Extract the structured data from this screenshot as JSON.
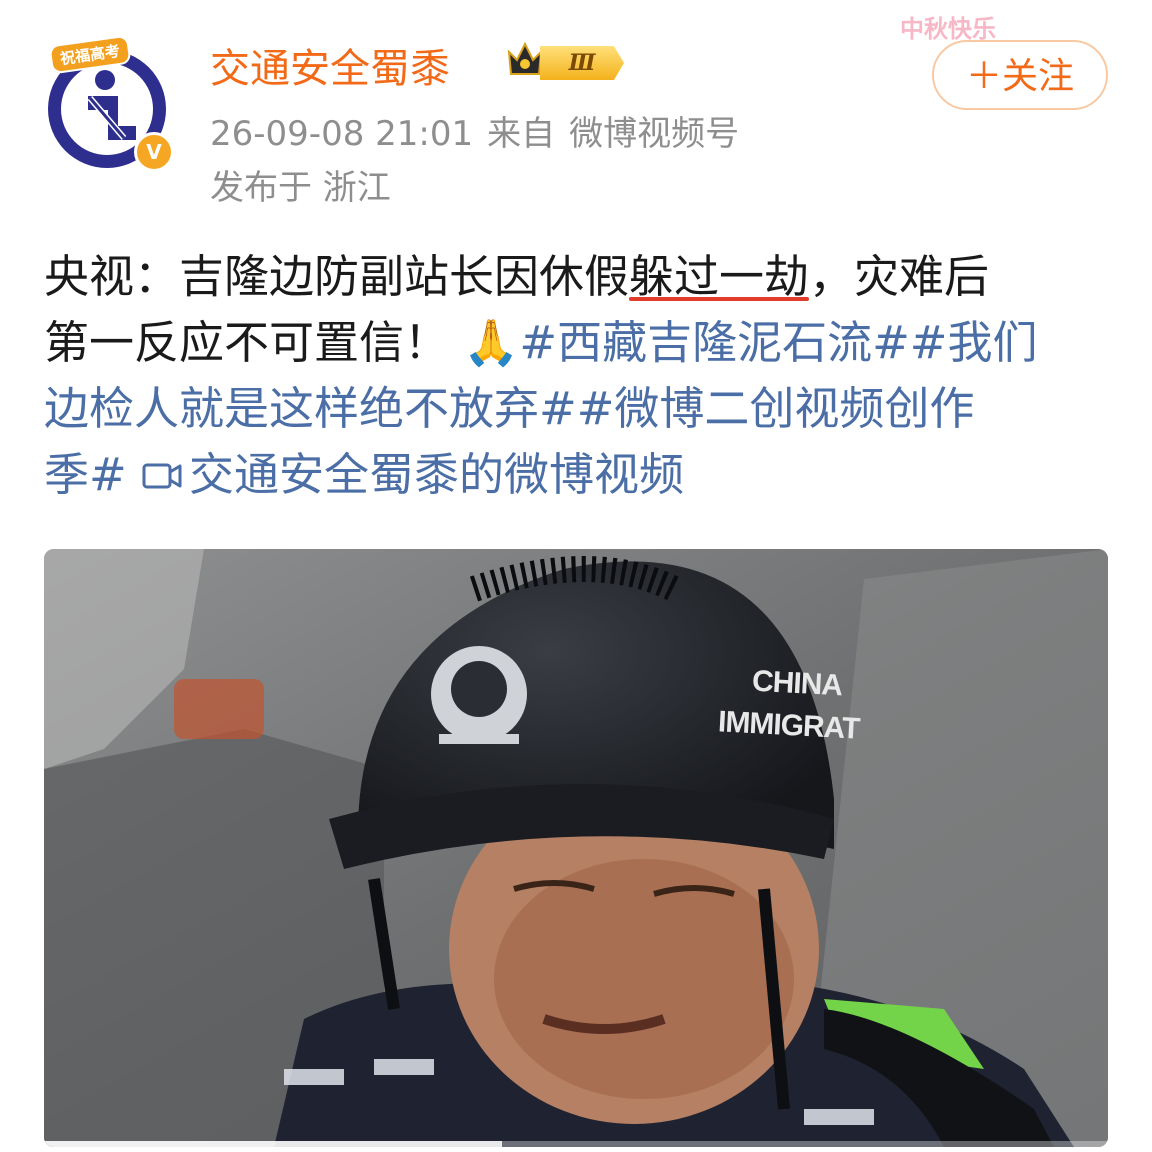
{
  "post": {
    "avatar_badge": "祝福高考",
    "author": "交通安全蜀黍",
    "level": "Ⅲ",
    "verified_mark": "V",
    "timestamp": "26-09-08 21:01",
    "source_prefix": "来自",
    "source": "微博视频号",
    "location": "发布于 浙江",
    "follow_label": "＋关注",
    "deco_text": "中秋快乐"
  },
  "content": {
    "line1_a": "央视：吉隆边防副站长因休假",
    "line1_highlight": "躲过一劫",
    "line1_b": "，灾难后",
    "line2_text": "第一反应不可置信！",
    "line2_emoji": "🙏",
    "tag1": "#西藏吉隆泥石流#",
    "tag2_part1": "#我们",
    "tag2_part2": "边检人就是这样绝不放弃#",
    "tag3_part1": "#微博二创视频创作",
    "tag3_part2": "季#",
    "video_link_text": "交通安全蜀黍的微博视频"
  },
  "video": {
    "helmet_line1": "CHINA",
    "helmet_line2": "IMMIGRAT",
    "progress": 0.43
  },
  "colors": {
    "accent": "#f26a18",
    "link": "#4a6ea5",
    "meta": "#8e8e8e",
    "highlight_underline": "#e23b2a"
  }
}
